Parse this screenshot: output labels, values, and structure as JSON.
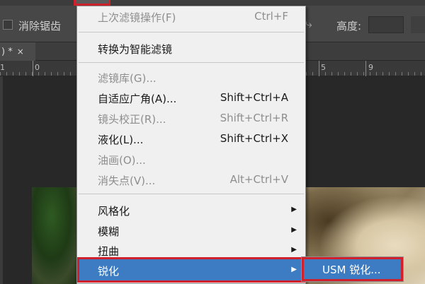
{
  "toolbar": {
    "antialias_label": "消除锯齿",
    "height_label": "高度:"
  },
  "document": {
    "tab_title": ") *",
    "close_glyph": "×"
  },
  "ruler": {
    "labels": [
      "1",
      "0",
      "9",
      "5"
    ]
  },
  "menu": {
    "items": [
      {
        "label": "上次滤镜操作(F)",
        "shortcut": "Ctrl+F",
        "enabled": false
      },
      {
        "label": "转换为智能滤镜",
        "shortcut": "",
        "enabled": true
      },
      {
        "label": "滤镜库(G)...",
        "shortcut": "",
        "enabled": false
      },
      {
        "label": "自适应广角(A)...",
        "shortcut": "Shift+Ctrl+A",
        "enabled": true
      },
      {
        "label": "镜头校正(R)...",
        "shortcut": "Shift+Ctrl+R",
        "enabled": false
      },
      {
        "label": "液化(L)...",
        "shortcut": "Shift+Ctrl+X",
        "enabled": true
      },
      {
        "label": "油画(O)...",
        "shortcut": "",
        "enabled": false
      },
      {
        "label": "消失点(V)...",
        "shortcut": "Alt+Ctrl+V",
        "enabled": false
      },
      {
        "label": "风格化",
        "submenu": true
      },
      {
        "label": "模糊",
        "submenu": true
      },
      {
        "label": "扭曲",
        "submenu": true
      },
      {
        "label": "锐化",
        "submenu": true,
        "selected": true
      }
    ]
  },
  "submenu": {
    "items": [
      {
        "label": "USM 锐化...",
        "selected": true
      }
    ]
  },
  "colors": {
    "highlight": "#3d7cc2",
    "annotation": "#d0202c"
  }
}
